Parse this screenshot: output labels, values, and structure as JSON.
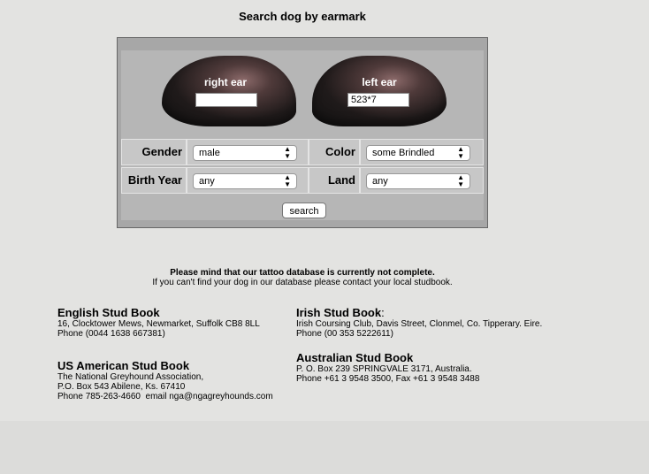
{
  "title": "Search dog by earmark",
  "ears": {
    "right": {
      "label": "right ear",
      "value": ""
    },
    "left": {
      "label": "left ear",
      "value": "523*7"
    }
  },
  "filters": {
    "gender": {
      "label": "Gender",
      "value": "male"
    },
    "color": {
      "label": "Color",
      "value": "some Brindled"
    },
    "birth_year": {
      "label": "Birth Year",
      "value": "any"
    },
    "land": {
      "label": "Land",
      "value": "any"
    }
  },
  "search_label": "search",
  "notice": {
    "line1": "Please mind that our tattoo database is currently not complete.",
    "line2": "If you can't find your dog in our database please contact your local studbook."
  },
  "studbooks": {
    "english": {
      "name": "English Stud Book",
      "lines": [
        "16, Clocktower Mews, Newmarket, Suffolk CB8 8LL",
        "Phone (0044 1638 667381)"
      ]
    },
    "irish": {
      "name": "Irish Stud Book",
      "suffix": ":",
      "lines": [
        "Irish Coursing Club, Davis Street, Clonmel, Co. Tipperary. Eire.",
        "Phone (00 353 5222611)"
      ]
    },
    "american": {
      "name": "US American Stud Book",
      "lines": [
        "The National Greyhound Association,",
        "P.O. Box 543 Abilene, Ks. 67410",
        "Phone 785-263-4660  email nga@ngagreyhounds.com"
      ]
    },
    "australian": {
      "name": "Australian Stud Book",
      "lines": [
        "P. O. Box 239 SPRINGVALE 3171, Australia.",
        "Phone +61 3 9548 3500, Fax +61 3 9548 3488"
      ]
    }
  }
}
